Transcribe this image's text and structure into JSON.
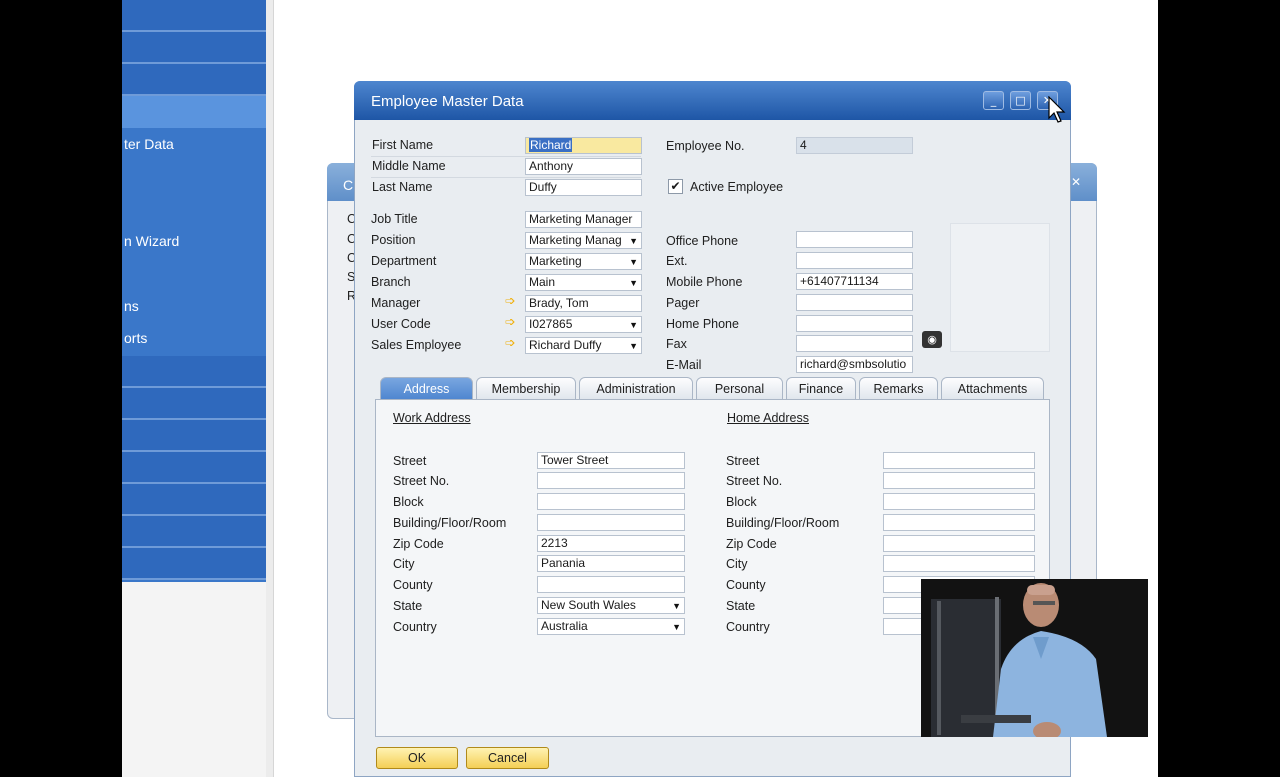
{
  "nav": {
    "items": [
      "ter Data",
      "n Wizard",
      "ns",
      "orts"
    ]
  },
  "background_dialog": {
    "title_initial": "C",
    "row_initials": [
      "C",
      "C",
      "C",
      "S",
      "R"
    ]
  },
  "dialog": {
    "title": "Employee Master Data",
    "window_controls": {
      "minimize": "_",
      "maximize": "□",
      "close": "✕"
    }
  },
  "header": {
    "first_name_label": "First Name",
    "first_name": "Richard",
    "middle_name_label": "Middle Name",
    "middle_name": "Anthony",
    "last_name_label": "Last Name",
    "last_name": "Duffy",
    "employee_no_label": "Employee No.",
    "employee_no": "4",
    "active_label": "Active Employee",
    "active_checked": true,
    "job_title_label": "Job Title",
    "job_title": "Marketing Manager",
    "position_label": "Position",
    "position": "Marketing Manag",
    "department_label": "Department",
    "department": "Marketing",
    "branch_label": "Branch",
    "branch": "Main",
    "manager_label": "Manager",
    "manager": "Brady, Tom",
    "user_code_label": "User Code",
    "user_code": "I027865",
    "sales_employee_label": "Sales Employee",
    "sales_employee": "Richard Duffy",
    "office_phone_label": "Office Phone",
    "office_phone": "",
    "ext_label": "Ext.",
    "ext": "",
    "mobile_phone_label": "Mobile Phone",
    "mobile_phone": "+61407711134",
    "pager_label": "Pager",
    "pager": "",
    "home_phone_label": "Home Phone",
    "home_phone": "",
    "fax_label": "Fax",
    "fax": "",
    "email_label": "E-Mail",
    "email": "richard@smbsolutio"
  },
  "tabs": [
    "Address",
    "Membership",
    "Administration",
    "Personal",
    "Finance",
    "Remarks",
    "Attachments"
  ],
  "address": {
    "work_heading": "Work Address",
    "home_heading": "Home Address",
    "labels": [
      "Street",
      "Street No.",
      "Block",
      "Building/Floor/Room",
      "Zip Code",
      "City",
      "County",
      "State",
      "Country"
    ],
    "work_values": [
      "Tower Street",
      "",
      "",
      "",
      "2213",
      "Panania",
      "",
      "New South Wales",
      "Australia"
    ],
    "home_values": [
      "",
      "",
      "",
      "",
      "",
      "",
      "",
      "",
      ""
    ]
  },
  "buttons": {
    "ok": "OK",
    "cancel": "Cancel"
  },
  "icons": {
    "camera": "camera-icon",
    "link_arrow": "link-arrow-icon",
    "dropdown": "chevron-down-icon",
    "cursor": "mouse-pointer-icon"
  },
  "colors": {
    "titlebar": "#2a62b2",
    "active_tab": "#5a8fd4",
    "button": "#f6d568",
    "nav": "#3a77c9"
  }
}
